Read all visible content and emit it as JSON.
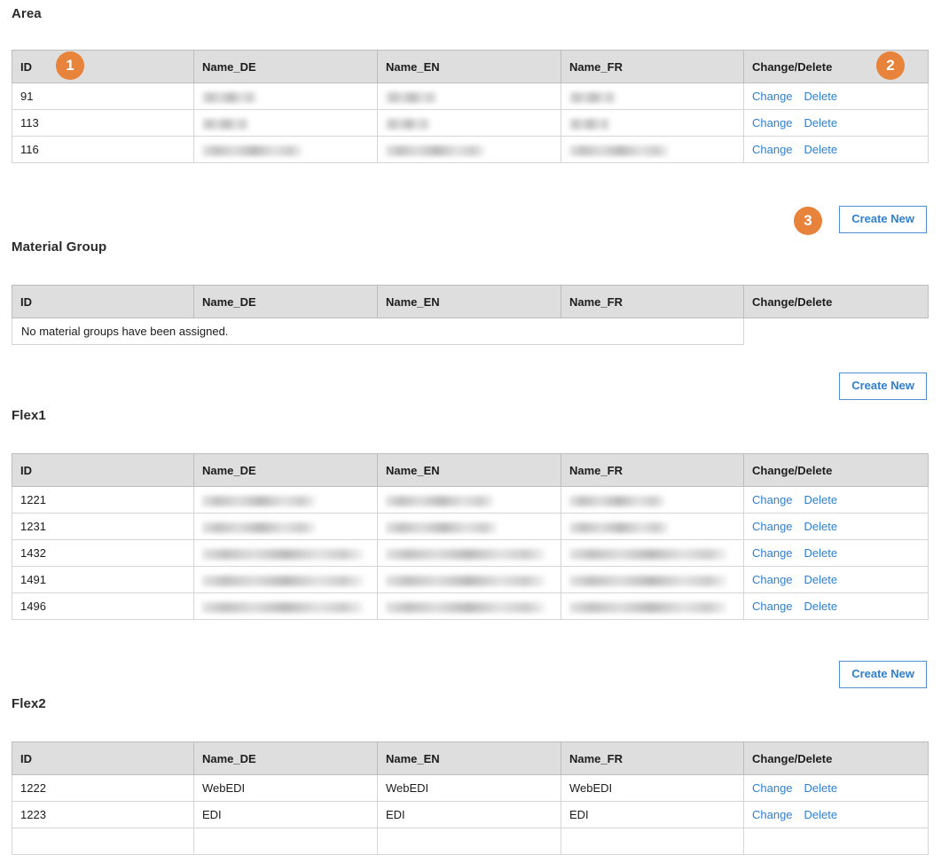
{
  "columns": [
    "ID",
    "Name_DE",
    "Name_EN",
    "Name_FR",
    "Change/Delete"
  ],
  "actions": {
    "change": "Change",
    "delete": "Delete",
    "create_new": "Create New"
  },
  "badges": [
    {
      "number": "1",
      "target": "area-table-id-header"
    },
    {
      "number": "2",
      "target": "area-table-action-header"
    },
    {
      "number": "3",
      "target": "area-create-new-button"
    }
  ],
  "sections": [
    {
      "key": "area",
      "title": "Area",
      "columns": [
        "ID",
        "Name_DE",
        "Name_EN",
        "Name_FR",
        "Change/Delete"
      ],
      "empty": false,
      "empty_message": "",
      "rows": [
        {
          "id": "91",
          "name_de": "",
          "name_en": "",
          "name_fr": "",
          "redacted": true,
          "widths": [
            62,
            58,
            53
          ]
        },
        {
          "id": "113",
          "name_de": "",
          "name_en": "",
          "name_fr": "",
          "redacted": true,
          "widths": [
            53,
            50,
            46
          ]
        },
        {
          "id": "116",
          "name_de": "",
          "name_en": "",
          "name_fr": "",
          "redacted": true,
          "widths": [
            113,
            112,
            112
          ]
        }
      ],
      "create_new": true
    },
    {
      "key": "material-group",
      "title": "Material Group",
      "columns": [
        "ID",
        "Name_DE",
        "Name_EN",
        "Name_FR",
        "Change/Delete"
      ],
      "empty": true,
      "empty_message": "No material groups have been assigned.",
      "rows": [],
      "create_new": true
    },
    {
      "key": "flex1",
      "title": "Flex1",
      "columns": [
        "ID",
        "Name_DE",
        "Name_EN",
        "Name_FR",
        "Change/Delete"
      ],
      "empty": false,
      "empty_message": "",
      "rows": [
        {
          "id": "1221",
          "name_de": "",
          "name_en": "",
          "name_fr": "",
          "redacted": true,
          "widths": [
            128,
            122,
            108
          ]
        },
        {
          "id": "1231",
          "name_de": "",
          "name_en": "",
          "name_fr": "",
          "redacted": true,
          "widths": [
            128,
            126,
            112
          ]
        },
        {
          "id": "1432",
          "name_de": "",
          "name_en": "",
          "name_fr": "",
          "redacted": true,
          "widths": [
            182,
            180,
            178
          ]
        },
        {
          "id": "1491",
          "name_de": "",
          "name_en": "",
          "name_fr": "",
          "redacted": true,
          "widths": [
            182,
            180,
            178
          ]
        },
        {
          "id": "1496",
          "name_de": "",
          "name_en": "",
          "name_fr": "",
          "redacted": true,
          "widths": [
            182,
            180,
            178
          ]
        }
      ],
      "create_new": true
    },
    {
      "key": "flex2",
      "title": "Flex2",
      "columns": [
        "ID",
        "Name_DE",
        "Name_EN",
        "Name_FR",
        "Change/Delete"
      ],
      "empty": false,
      "empty_message": "",
      "rows": [
        {
          "id": "1222",
          "name_de": "WebEDI",
          "name_en": "WebEDI",
          "name_fr": "WebEDI",
          "redacted": false,
          "widths": [
            0,
            0,
            0
          ]
        },
        {
          "id": "1223",
          "name_de": "EDI",
          "name_en": "EDI",
          "name_fr": "EDI",
          "redacted": false,
          "widths": [
            0,
            0,
            0
          ]
        },
        {
          "id": "",
          "name_de": "",
          "name_en": "",
          "name_fr": "",
          "redacted": false,
          "widths": [
            0,
            0,
            0
          ]
        }
      ],
      "create_new": false
    }
  ],
  "colors": {
    "badge": "#e8833c",
    "link": "#2f7fd1",
    "button_border": "#4f8fd0",
    "header_bg": "#dedede",
    "empty_row_bg": "#eeeeee"
  }
}
